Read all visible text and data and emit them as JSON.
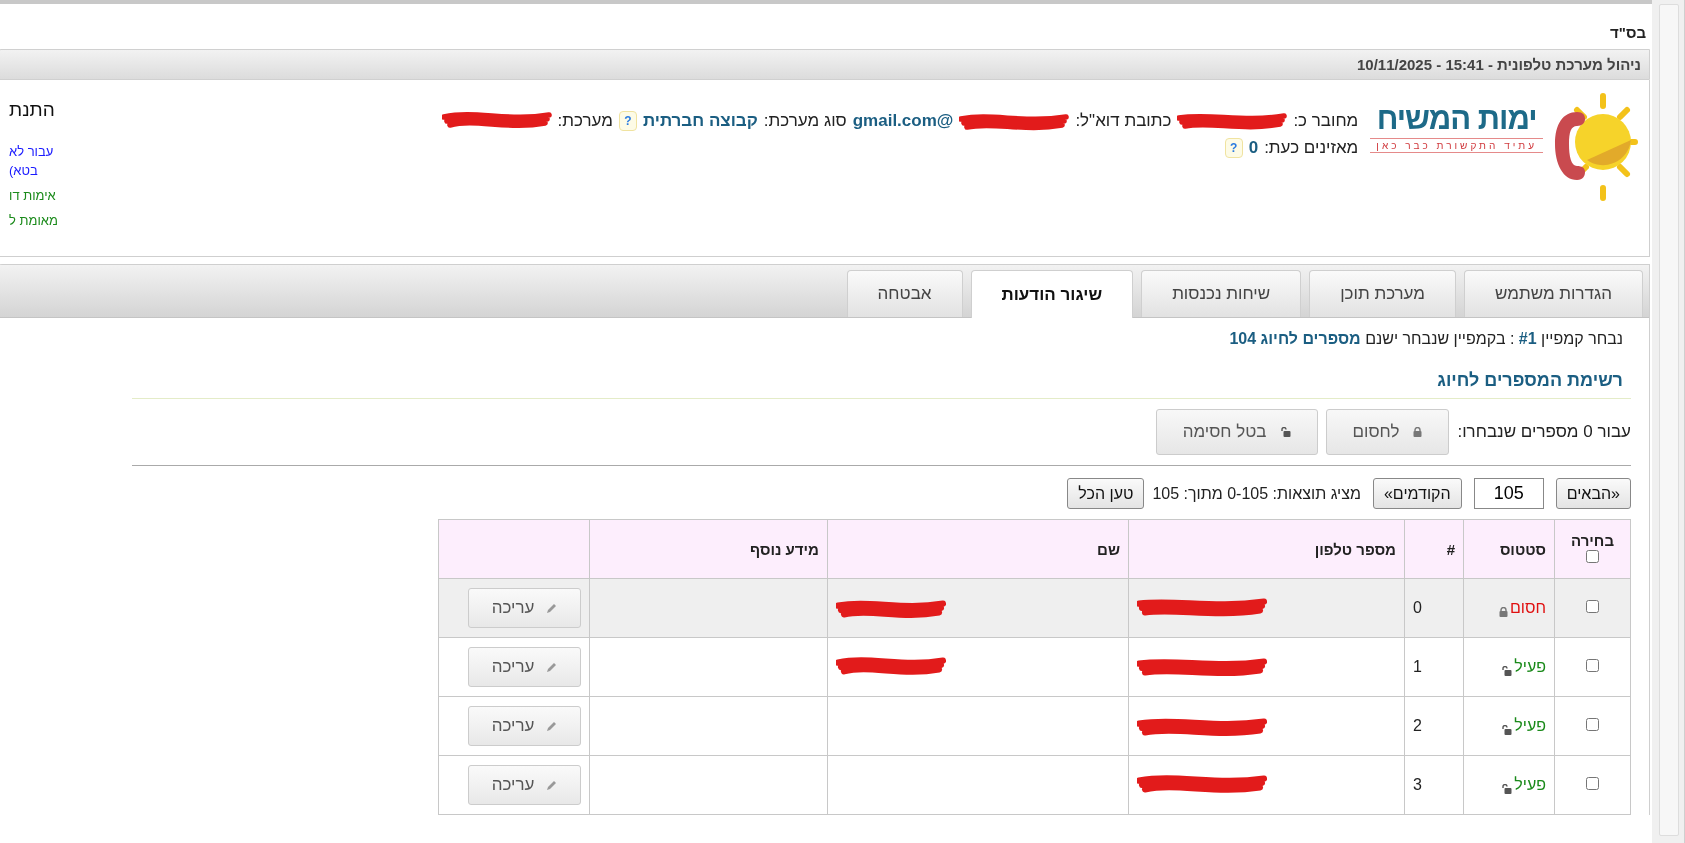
{
  "header_mark": "בס\"ד",
  "title_bar": "ניהול מערכת טלפונית - 15:41 - 10/11/2025",
  "logo": {
    "name": "ימות המשיח",
    "tagline": "עתיד התקשורת כבר כאן"
  },
  "account": {
    "lines": [
      {
        "fields": [
          {
            "label": "מחובר כ:",
            "redacted": true
          },
          {
            "label": "כתובת דוא\"ל:",
            "value": "@gmail.com",
            "redacted": true
          },
          {
            "label": "סוג מערכת:",
            "value": "קבוצה חברתית",
            "help": "?"
          },
          {
            "label": "מערכת:",
            "redacted": true
          }
        ]
      },
      {
        "fields": [
          {
            "label": "מאזינים כעת:",
            "value": "0",
            "help": "?"
          }
        ]
      }
    ]
  },
  "side": {
    "heading": "התנת",
    "items": [
      {
        "text": "עבור לא",
        "kind": "link"
      },
      {
        "text": "בטא)",
        "kind": "link"
      },
      {
        "text": "אימות דו",
        "kind": "status"
      },
      {
        "text": "מאומת ל",
        "kind": "status"
      }
    ]
  },
  "tabs": [
    {
      "label": "הגדרות משתמש",
      "selected": false
    },
    {
      "label": "מערכת תוכן",
      "selected": false
    },
    {
      "label": "שיחות נכנסות",
      "selected": false
    },
    {
      "label": "שיגור הודעות",
      "selected": true
    },
    {
      "label": "אבטחה",
      "selected": false
    }
  ],
  "campaign_info": "נבחר קמפיין **#1** : בקמפיין שנבחר ישנם **מספרים לחיוג 104**",
  "section_title": "רשימת המספרים לחיוג",
  "bulk_actions": {
    "label": "עבור 0 מספרים שנבחרו:",
    "buttons": [
      {
        "label": "לחסום",
        "kind": "lock"
      },
      {
        "label": "בטל חסימה",
        "kind": "unlock"
      }
    ]
  },
  "pagination": {
    "next": "«הבאים",
    "page_size": "105",
    "previous": "הקודמים»",
    "summary": "מציג תוצאות: 0-105 מתוך: 105",
    "load_all": "טען הכל"
  },
  "table": {
    "columns": [
      "בחירה",
      "סטטוס",
      "#",
      "מספר טלפון",
      "שם",
      "מידע נוסף"
    ],
    "select_all_checked": false,
    "rows": [
      {
        "checked": false,
        "status": "חסום",
        "kind": "blocked",
        "index": "0",
        "phone_redacted": true,
        "name_redacted": true,
        "action": "עריכה"
      },
      {
        "checked": false,
        "status": "פעיל",
        "kind": "active",
        "index": "1",
        "phone_redacted": true,
        "name_redacted": true,
        "action": "עריכה"
      },
      {
        "checked": false,
        "status": "פעיל",
        "kind": "active",
        "index": "2",
        "phone_redacted": true,
        "name_redacted": false,
        "action": "עריכה"
      },
      {
        "checked": false,
        "status": "פעיל",
        "kind": "active",
        "index": "3",
        "phone_redacted": true,
        "name_redacted": false,
        "action": "עריכה"
      }
    ]
  }
}
